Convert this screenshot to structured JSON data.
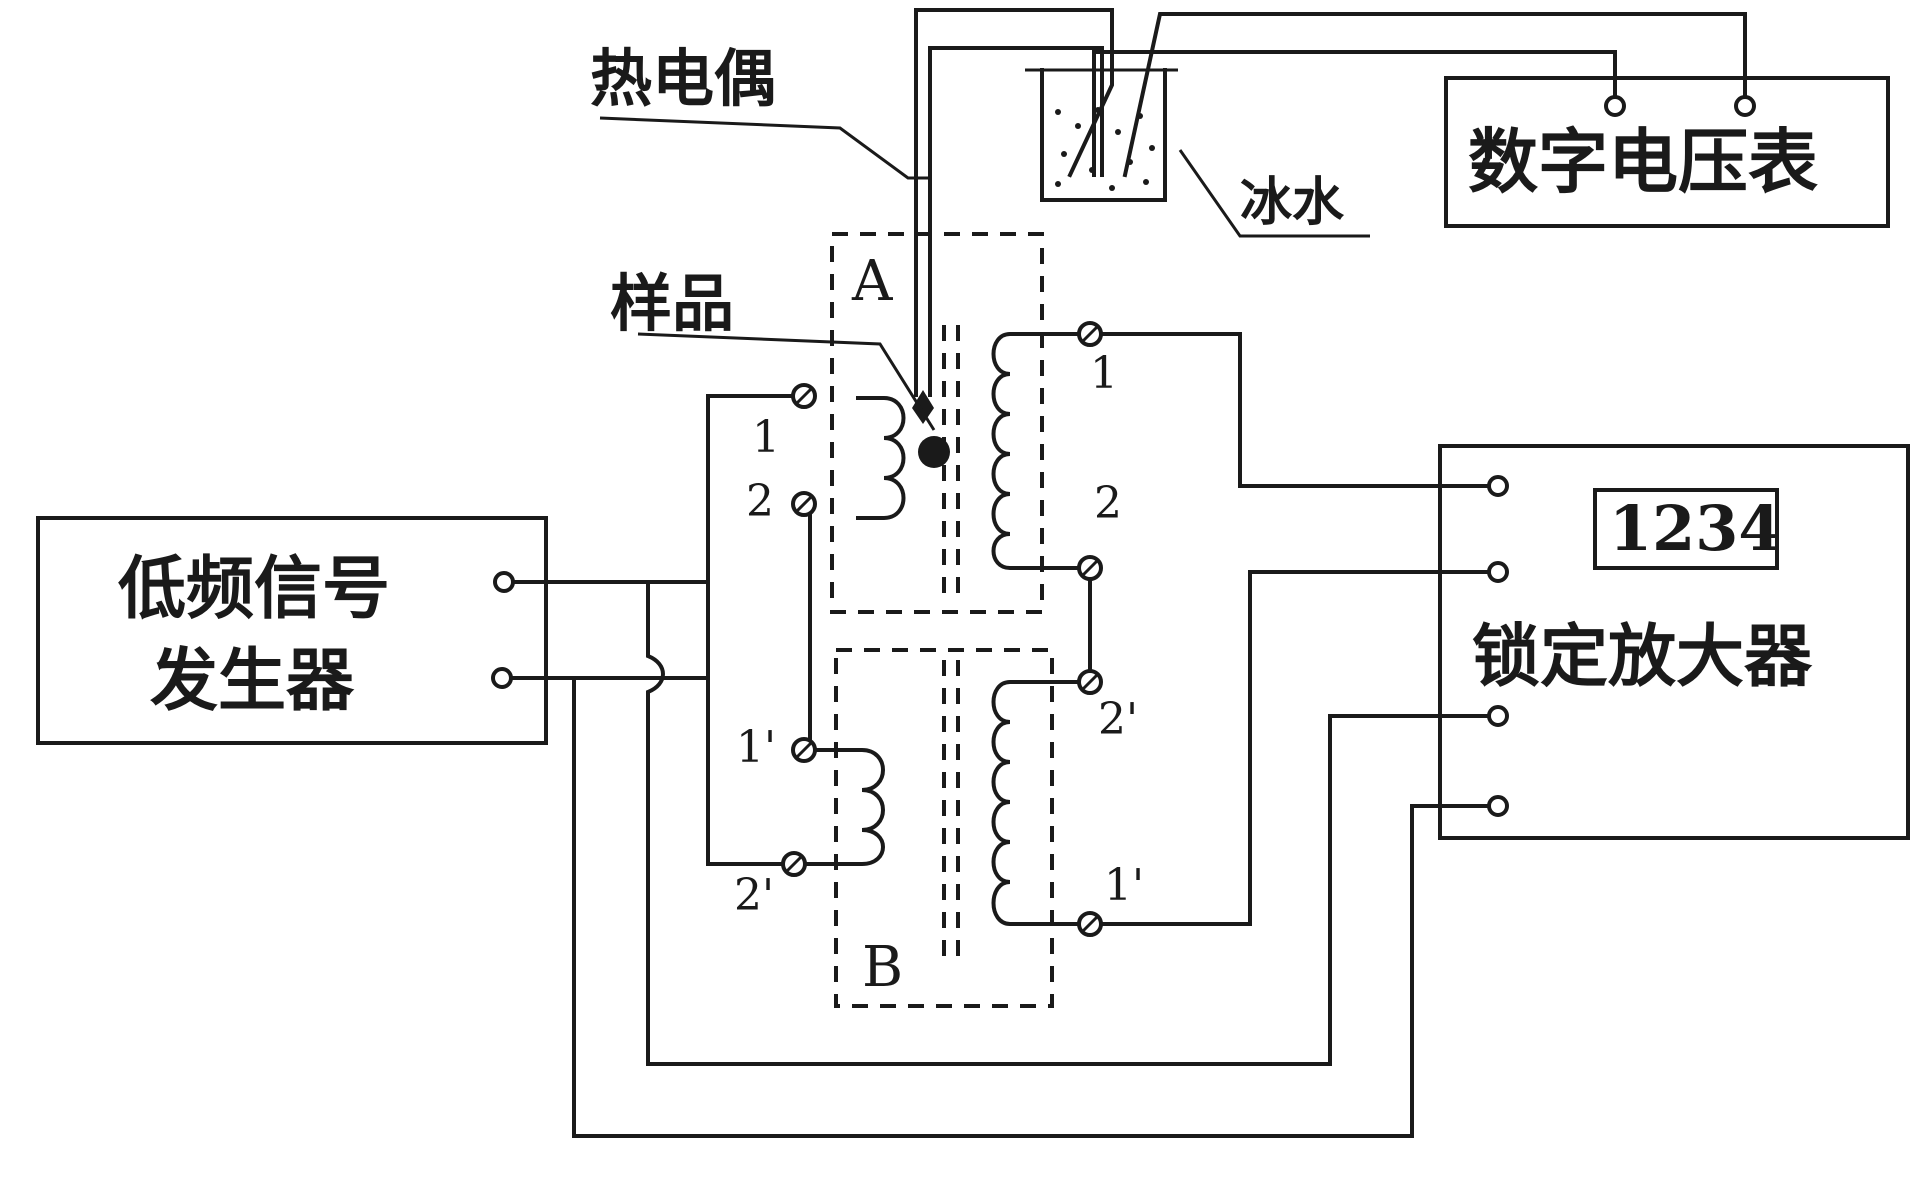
{
  "labels": {
    "thermocouple": "热电偶",
    "ice_water": "冰水",
    "voltmeter": "数字电压表",
    "sample": "样品",
    "coil_a": "A",
    "coil_b": "B",
    "generator_line1": "低频信号",
    "generator_line2": "发生器",
    "lockin_display": "1234",
    "lockin": "锁定放大器",
    "terminal_1": "1",
    "terminal_2": "2",
    "terminal_1p": "1'",
    "terminal_2p": "2'"
  },
  "colors": {
    "ink": "#1a1a1a",
    "paper": "#ffffff"
  }
}
